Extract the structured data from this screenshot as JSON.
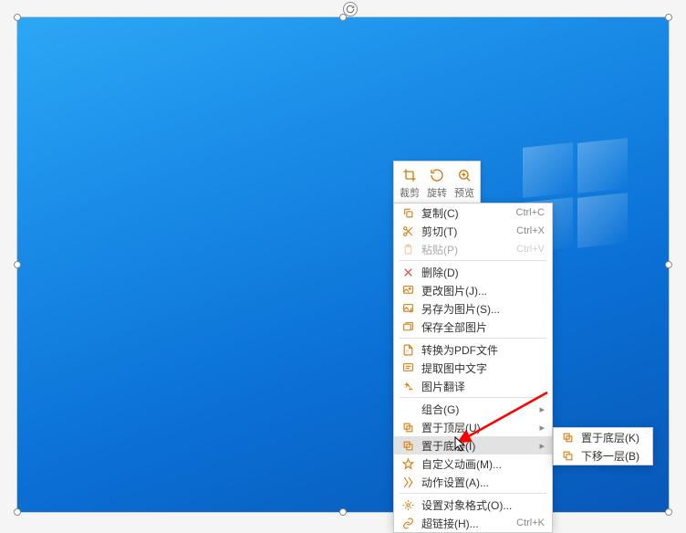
{
  "toolbar": {
    "crop": "裁剪",
    "rotate": "旋转",
    "preview": "预览"
  },
  "menu": {
    "copy": "复制(C)",
    "cut": "剪切(T)",
    "paste": "粘贴(P)",
    "delete": "删除(D)",
    "changeImage": "更改图片(J)...",
    "saveAsImage": "另存为图片(S)...",
    "saveAllImages": "保存全部图片",
    "convertPDF": "转换为PDF文件",
    "extractText": "提取图中文字",
    "imageTranslate": "图片翻译",
    "group": "组合(G)",
    "bringFront": "置于顶层(U)",
    "sendBack": "置于底层(I)",
    "customAnim": "自定义动画(M)...",
    "actionSettings": "动作设置(A)...",
    "objectFormat": "设置对象格式(O)...",
    "hyperlink": "超链接(H)...",
    "shortcuts": {
      "copy": "Ctrl+C",
      "cut": "Ctrl+X",
      "paste": "Ctrl+V",
      "hyperlink": "Ctrl+K"
    }
  },
  "submenu": {
    "sendToBack": "置于底层(K)",
    "moveDownOne": "下移一层(B)"
  }
}
